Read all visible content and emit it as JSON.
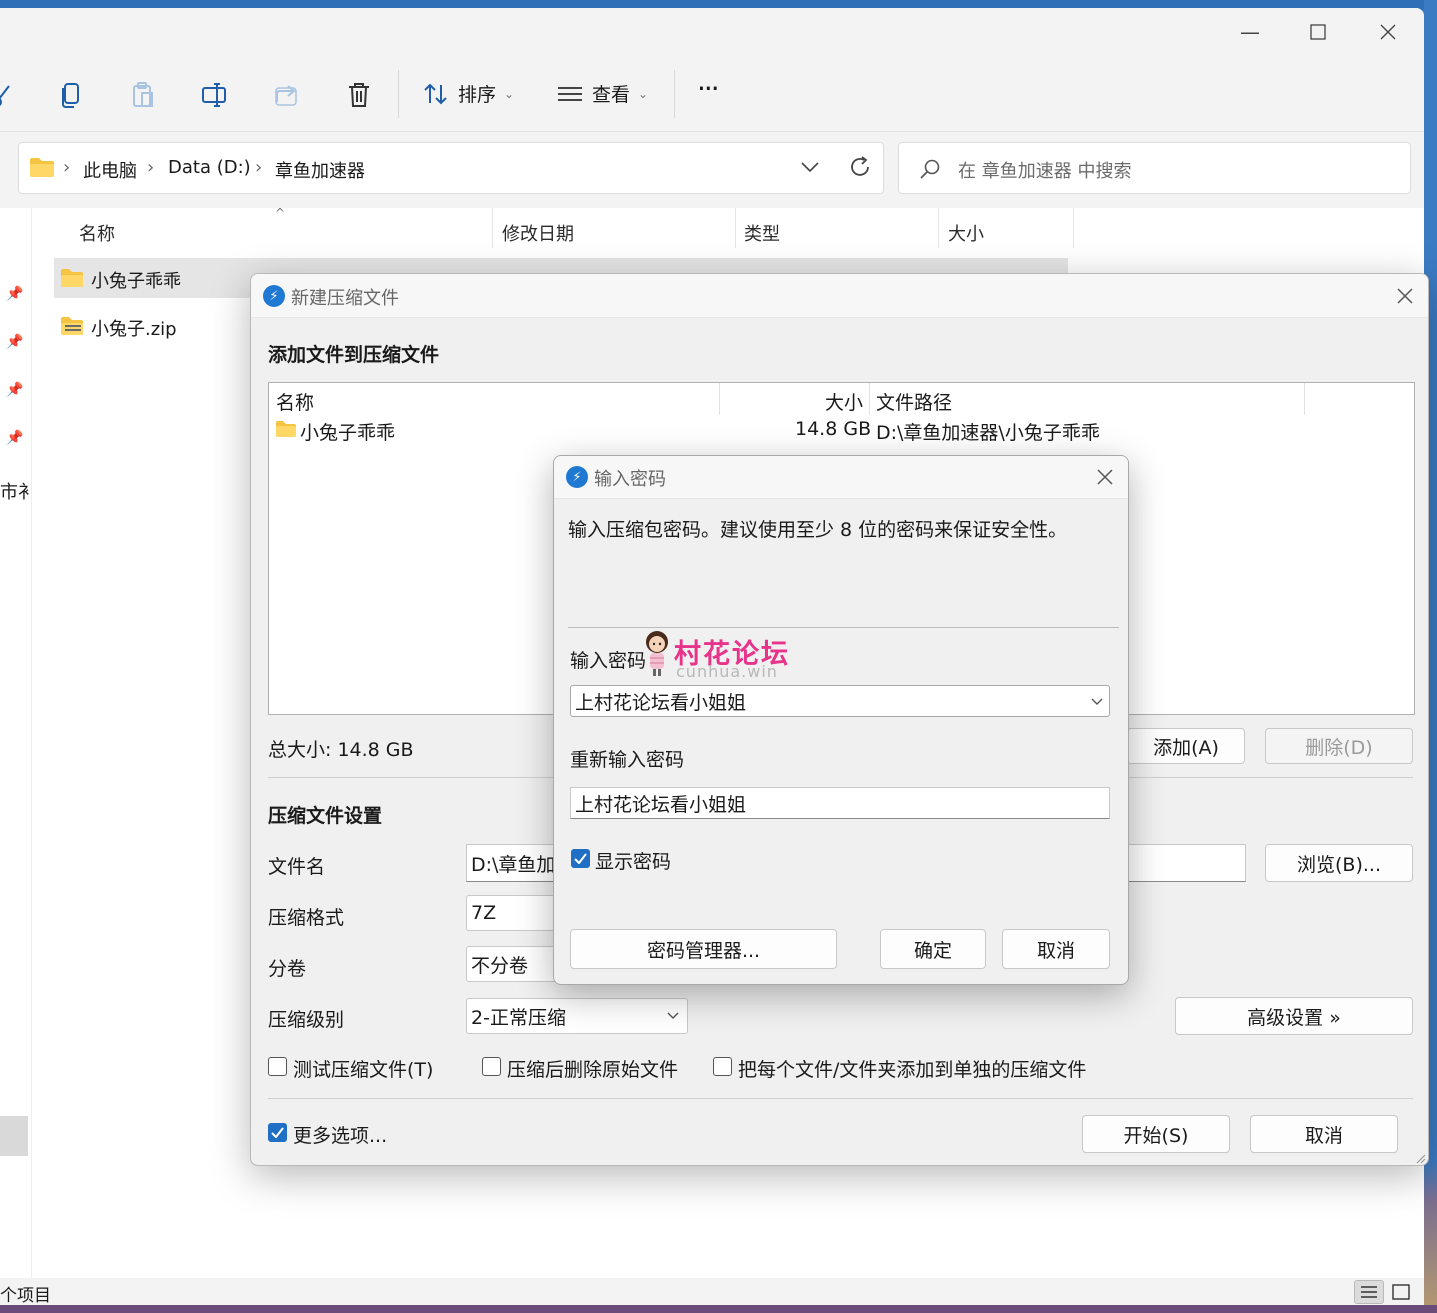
{
  "explorer": {
    "toolbar": {
      "sort_label": "排序",
      "view_label": "查看",
      "more_label": "···"
    },
    "breadcrumb": [
      "此电脑",
      "Data (D:)",
      "章鱼加速器"
    ],
    "search_placeholder": "在 章鱼加速器 中搜索",
    "columns": [
      "名称",
      "修改日期",
      "类型",
      "大小"
    ],
    "files": [
      {
        "name": "小兔子乖乖",
        "icon": "folder-icon"
      },
      {
        "name": "小兔子.zip",
        "icon": "zip-folder-icon"
      }
    ],
    "nav_fragment": "市衤",
    "status_fragment": "个项目"
  },
  "compress_dialog": {
    "title": "新建压缩文件",
    "add_section": "添加文件到压缩文件",
    "list_columns": {
      "name": "名称",
      "size": "大小",
      "path": "文件路径"
    },
    "list_rows": [
      {
        "name": "小兔子乖乖",
        "size": "14.8 GB",
        "path": "D:\\章鱼加速器\\小兔子乖乖"
      }
    ],
    "total_size": "总大小: 14.8 GB",
    "add_button": "添加(A)",
    "delete_button": "删除(D)",
    "settings_section": "压缩文件设置",
    "filename_label": "文件名",
    "filename_value": "D:\\章鱼加",
    "browse_button": "浏览(B)...",
    "format_label": "压缩格式",
    "format_value": "7Z",
    "split_label": "分卷",
    "split_value": "不分卷",
    "level_label": "压缩级别",
    "level_value": "2-正常压缩",
    "advanced_button": "高级设置 »",
    "test_archive": "测试压缩文件(T)",
    "delete_after": "压缩后删除原始文件",
    "separate_archives": "把每个文件/文件夹添加到单独的压缩文件",
    "more_options": "更多选项...",
    "start_button": "开始(S)",
    "cancel_button": "取消"
  },
  "password_dialog": {
    "title": "输入密码",
    "hint": "输入压缩包密码。建议使用至少 8 位的密码来保证安全性。",
    "enter_label": "输入密码",
    "enter_value": "上村花论坛看小姐姐",
    "reenter_label": "重新输入密码",
    "reenter_value": "上村花论坛看小姐姐",
    "show_password": "显示密码",
    "show_password_checked": true,
    "manager_button": "密码管理器...",
    "ok_button": "确定",
    "cancel_button": "取消"
  },
  "watermark": {
    "title": "村花论坛",
    "subtitle": "cunhua.win"
  },
  "colors": {
    "accent": "#1f6fc5",
    "watermark": "#e8338a"
  }
}
